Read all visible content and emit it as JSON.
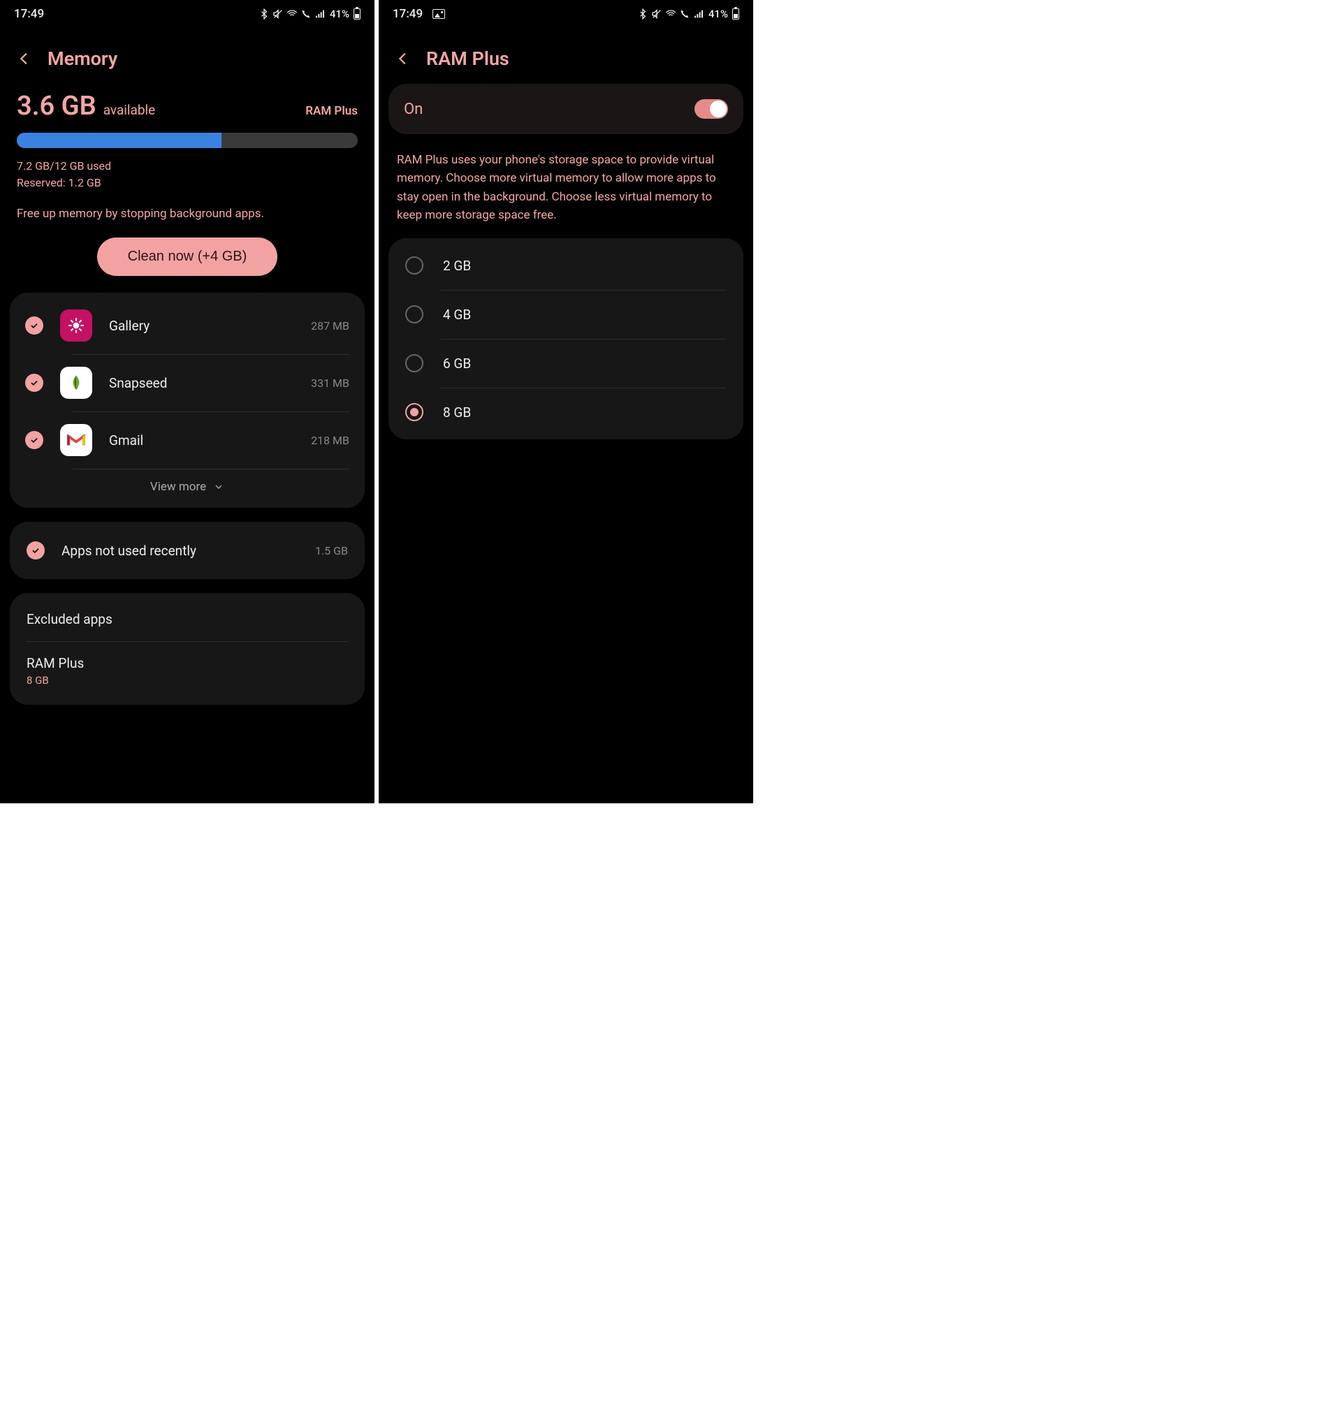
{
  "left": {
    "status": {
      "time": "17:49",
      "battery": "41%"
    },
    "title": "Memory",
    "available_value": "3.6 GB",
    "available_label": "available",
    "ramplus_link": "RAM Plus",
    "progress_pct": 60,
    "used_line": "7.2 GB/12 GB used",
    "reserved_line": "Reserved: 1.2 GB",
    "hint": "Free up memory by stopping background apps.",
    "clean_button": "Clean now (+4 GB)",
    "apps": [
      {
        "name": "Gallery",
        "size": "287 MB",
        "icon": "gallery"
      },
      {
        "name": "Snapseed",
        "size": "331 MB",
        "icon": "snapseed"
      },
      {
        "name": "Gmail",
        "size": "218 MB",
        "icon": "gmail"
      }
    ],
    "view_more": "View more",
    "not_recent": {
      "label": "Apps not used recently",
      "size": "1.5 GB"
    },
    "settings": [
      {
        "title": "Excluded apps",
        "sub": ""
      },
      {
        "title": "RAM Plus",
        "sub": "8 GB"
      }
    ]
  },
  "right": {
    "status": {
      "time": "17:49",
      "battery": "41%"
    },
    "title": "RAM Plus",
    "toggle_label": "On",
    "description": "RAM Plus uses your phone's storage space to provide virtual memory. Choose more virtual memory to allow more apps to stay open in the background. Choose less virtual memory to keep more storage space free.",
    "options": [
      {
        "label": "2 GB",
        "selected": false
      },
      {
        "label": "4 GB",
        "selected": false
      },
      {
        "label": "6 GB",
        "selected": false
      },
      {
        "label": "8 GB",
        "selected": true
      }
    ]
  }
}
